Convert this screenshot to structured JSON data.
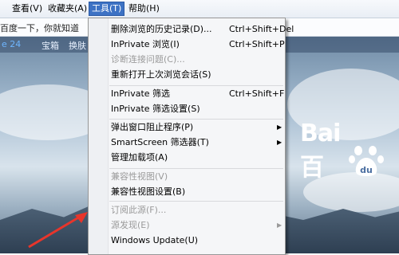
{
  "menubar": {
    "items": [
      "查看(V)",
      "收藏夹(A)",
      "工具(T)",
      "帮助(H)"
    ]
  },
  "favorites": {
    "tab_title": "百度一下，你就知道"
  },
  "page": {
    "nav_left": "e 24",
    "nav_links": [
      "宝箱",
      "换肤"
    ],
    "logo_text": "Bai",
    "logo_paw_text": "du",
    "logo_partial": "百"
  },
  "tools_menu": {
    "groups": [
      [
        {
          "label": "删除浏览的历史记录(D)...",
          "shortcut": "Ctrl+Shift+Del",
          "disabled": false
        },
        {
          "label": "InPrivate 浏览(I)",
          "shortcut": "Ctrl+Shift+P",
          "disabled": false
        },
        {
          "label": "诊断连接问题(C)...",
          "shortcut": "",
          "disabled": true
        },
        {
          "label": "重新打开上次浏览会话(S)",
          "shortcut": "",
          "disabled": false
        }
      ],
      [
        {
          "label": "InPrivate 筛选",
          "shortcut": "Ctrl+Shift+F",
          "disabled": false
        },
        {
          "label": "InPrivate 筛选设置(S)",
          "shortcut": "",
          "disabled": false
        }
      ],
      [
        {
          "label": "弹出窗口阻止程序(P)",
          "shortcut": "",
          "disabled": false,
          "submenu": true
        },
        {
          "label": "SmartScreen 筛选器(T)",
          "shortcut": "",
          "disabled": false,
          "submenu": true
        },
        {
          "label": "管理加载项(A)",
          "shortcut": "",
          "disabled": false
        }
      ],
      [
        {
          "label": "兼容性视图(V)",
          "shortcut": "",
          "disabled": true
        },
        {
          "label": "兼容性视图设置(B)",
          "shortcut": "",
          "disabled": false
        }
      ],
      [
        {
          "label": "订阅此源(F)...",
          "shortcut": "",
          "disabled": true
        },
        {
          "label": "源发现(E)",
          "shortcut": "",
          "disabled": true,
          "submenu": true
        },
        {
          "label": "Windows Update(U)",
          "shortcut": "",
          "disabled": false
        }
      ]
    ],
    "submenu_glyph": "▶"
  },
  "colors": {
    "menu_highlight": "#3d72c4",
    "arrow": "#e8352b"
  }
}
